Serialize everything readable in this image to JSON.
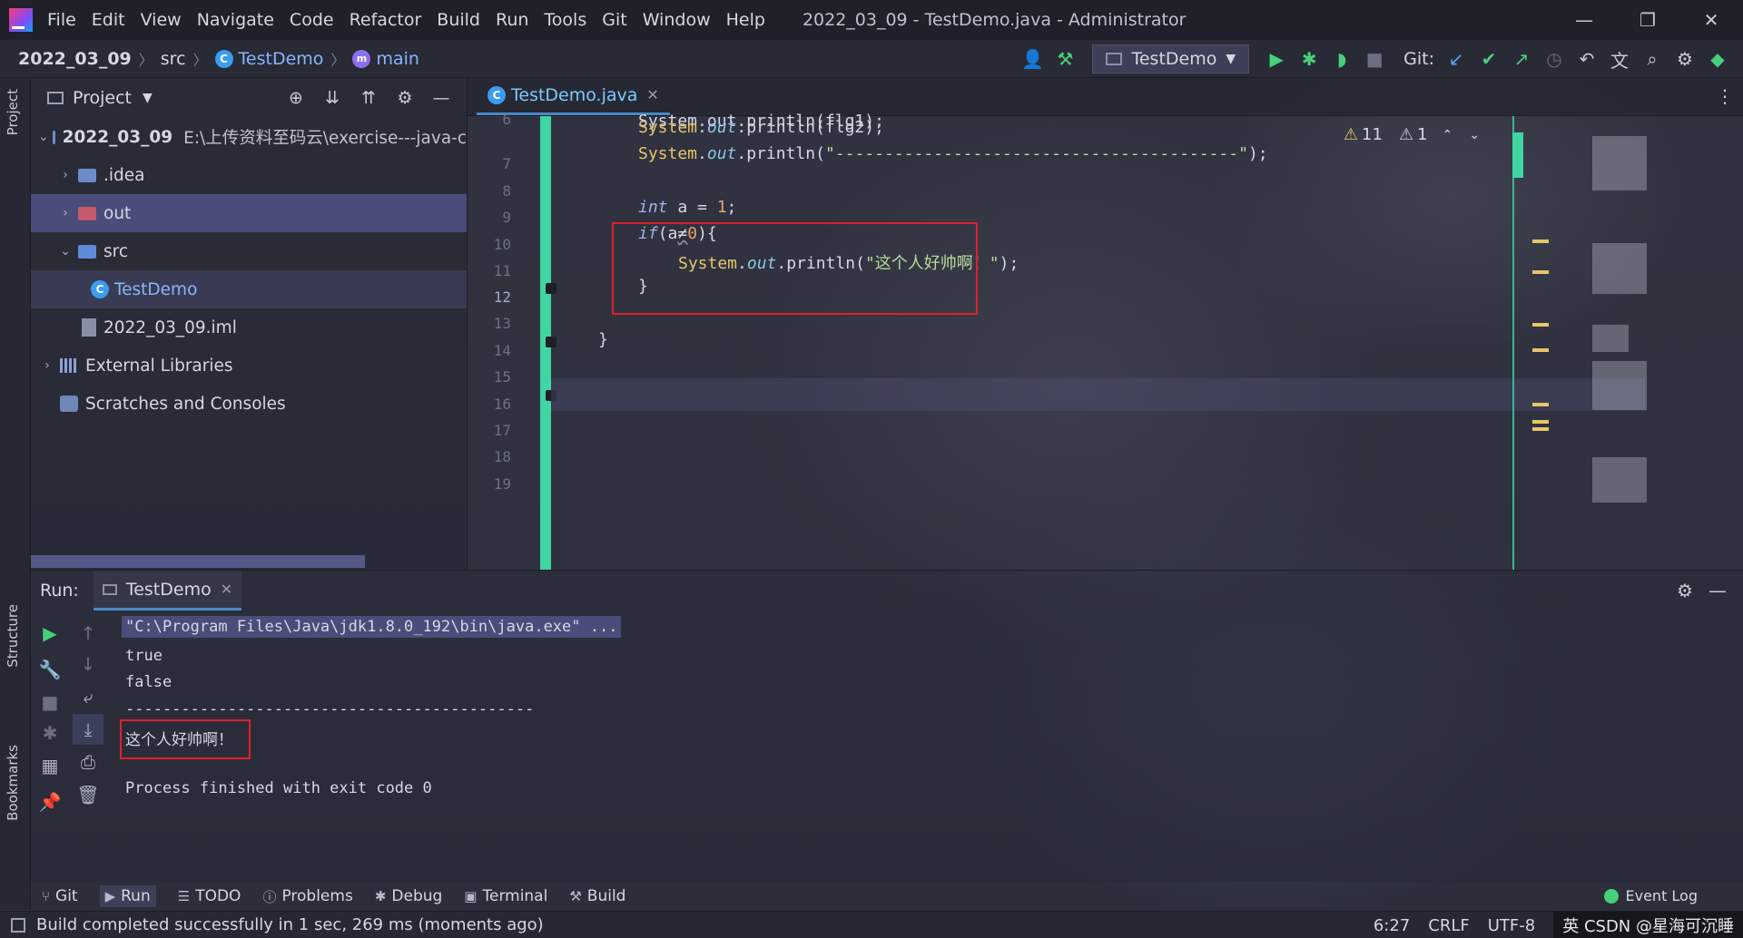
{
  "menubar": {
    "items": [
      "File",
      "Edit",
      "View",
      "Navigate",
      "Code",
      "Refactor",
      "Build",
      "Run",
      "Tools",
      "Git",
      "Window",
      "Help"
    ],
    "window_title": "2022_03_09 - TestDemo.java - Administrator"
  },
  "breadcrumb": {
    "project": "2022_03_09",
    "folder": "src",
    "class": "TestDemo",
    "method": "main"
  },
  "toolbar": {
    "run_config": "TestDemo",
    "git_label": "Git:"
  },
  "left_strip": {
    "project_label": "Project",
    "structure_label": "Structure",
    "bookmarks_label": "Bookmarks"
  },
  "project_panel": {
    "title": "Project",
    "root_name": "2022_03_09",
    "root_path": "E:\\上传资料至码云\\exercise---java-c",
    "items": [
      {
        "label": ".idea"
      },
      {
        "label": "out"
      },
      {
        "label": "src"
      },
      {
        "label": "TestDemo"
      },
      {
        "label": "2022_03_09.iml"
      },
      {
        "label": "External Libraries"
      },
      {
        "label": "Scratches and Consoles"
      }
    ]
  },
  "editor": {
    "tab_label": "TestDemo.java",
    "warnings_count": "11",
    "weak_warnings_count": "1",
    "line_numbers": [
      "6",
      "7",
      "8",
      "9",
      "10",
      "11",
      "12",
      "13",
      "14",
      "15",
      "16",
      "17",
      "18",
      "19"
    ],
    "current_line": "12",
    "code": {
      "line6_text": "System.out.println(flg1);",
      "line7": {
        "sys": "System",
        "dot1": ".",
        "out": "out",
        "rest": ".println(flg2);"
      },
      "line8": {
        "sys": "System",
        "dot1": ".",
        "out": "out",
        "open": ".println(",
        "str": "\"-----------------------------------------\"",
        "close": ");"
      },
      "line10": {
        "kw": "int",
        "mid": " a = ",
        "num": "1",
        "end": ";"
      },
      "line11": {
        "kw": "if",
        "open": "(a",
        "op": "≠",
        "num": "0",
        "close": "){"
      },
      "line12": {
        "sys": "System",
        "dot1": ".",
        "out": "out",
        "open": ".println(",
        "str": "\"这个人好帅啊！\"",
        "close": ");"
      },
      "line13": "}",
      "line15": "}"
    }
  },
  "run_panel": {
    "label": "Run:",
    "tab_label": "TestDemo",
    "console": [
      "\"C:\\Program Files\\Java\\jdk1.8.0_192\\bin\\java.exe\" ...",
      "true",
      "false",
      "--------------------------------------------",
      "这个人好帅啊！",
      "Process finished with exit code 0"
    ]
  },
  "toolwindows": {
    "items": [
      "Git",
      "Run",
      "TODO",
      "Problems",
      "Debug",
      "Terminal",
      "Build"
    ],
    "event_log": "Event Log"
  },
  "statusbar": {
    "message": "Build completed successfully in 1 sec, 269 ms (moments ago)",
    "position": "6:27",
    "line_sep": "CRLF",
    "encoding": "UTF-8",
    "watermark": "英 CSDN @星海可沉睡"
  },
  "colors": {
    "highlight_box": "#e0202a",
    "change_bar": "#3fd6a4",
    "selection": "#4a4c7a"
  }
}
